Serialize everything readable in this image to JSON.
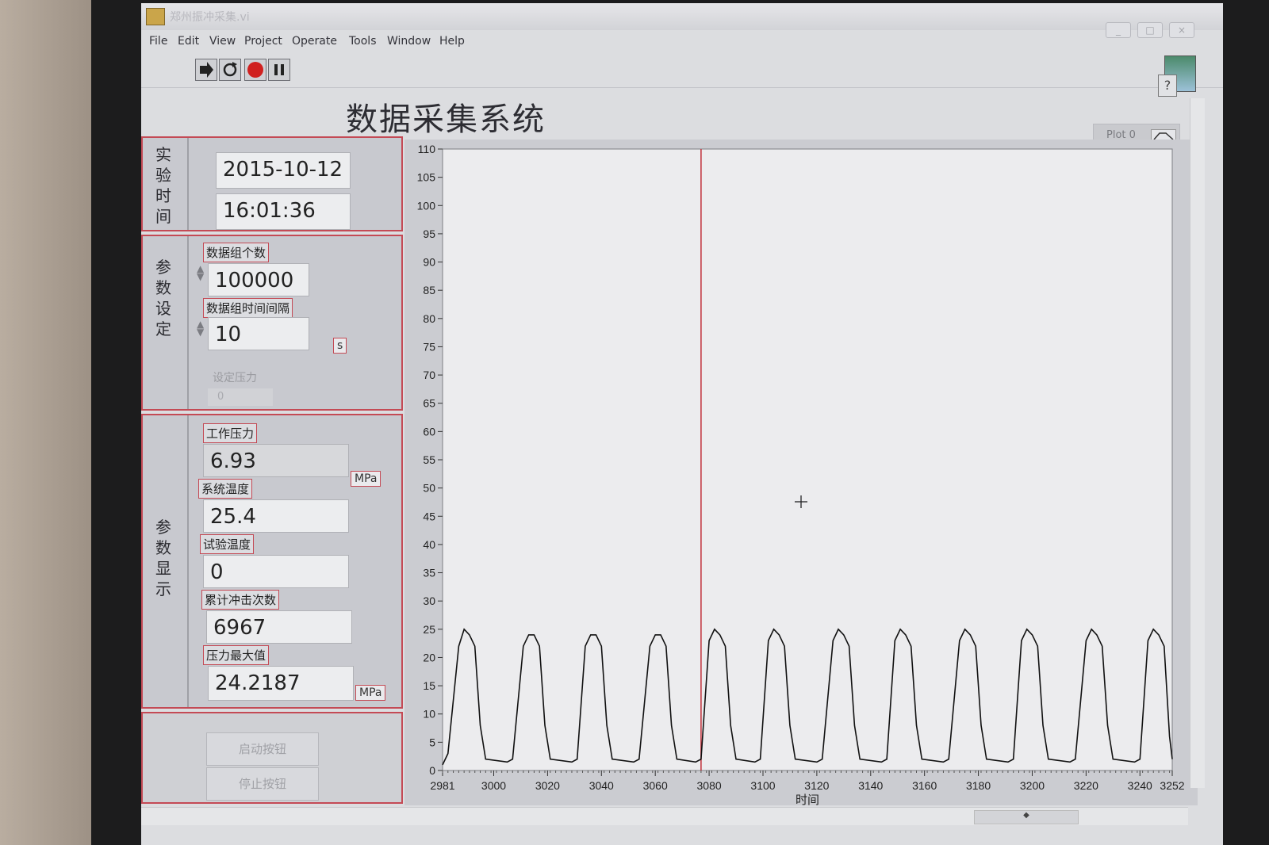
{
  "window": {
    "title": "郑州振冲采集.vi",
    "menu": [
      "File",
      "Edit",
      "View",
      "Project",
      "Operate",
      "Tools",
      "Window",
      "Help"
    ]
  },
  "page_title": "数据采集系统",
  "experiment_time": {
    "label": "实验时间",
    "date": "2015-10-12",
    "time": "16:01:36"
  },
  "params": {
    "label": "参数设定",
    "group_count_label": "数据组个数",
    "group_count": "100000",
    "interval_label": "数据组时间间隔",
    "interval": "10",
    "interval_unit": "s",
    "set_pressure_label": "设定压力",
    "set_pressure": "0"
  },
  "display": {
    "label": "参数显示",
    "work_pressure_label": "工作压力",
    "work_pressure": "6.93",
    "work_pressure_unit": "MPa",
    "sys_temp_label": "系统温度",
    "sys_temp": "25.4",
    "test_temp_label": "试验温度",
    "test_temp": "0",
    "impact_count_label": "累计冲击次数",
    "impact_count": "6967",
    "max_pressure_label": "压力最大值",
    "max_pressure": "24.2187",
    "max_pressure_unit": "MPa"
  },
  "buttons": {
    "start": "启动按钮",
    "stop": "停止按钮"
  },
  "legend": {
    "plot_name": "Plot 0"
  },
  "colors": {
    "panel_border": "#c44a55",
    "trace": "#111111",
    "cursor": "#c0303a"
  },
  "chart_data": {
    "type": "line",
    "xlabel": "时间",
    "ylabel": "",
    "xlim": [
      2981,
      3252
    ],
    "ylim": [
      0,
      110
    ],
    "x_ticks": [
      2981,
      3000,
      3020,
      3040,
      3060,
      3080,
      3100,
      3120,
      3140,
      3160,
      3180,
      3200,
      3220,
      3240,
      3252
    ],
    "y_ticks": [
      0,
      5,
      10,
      15,
      20,
      25,
      30,
      35,
      40,
      45,
      50,
      55,
      60,
      65,
      70,
      75,
      80,
      85,
      90,
      95,
      100,
      105,
      110
    ],
    "cursor_x": 3077,
    "series": [
      {
        "points": [
          [
            2981,
            1
          ],
          [
            2983,
            3
          ],
          [
            2987,
            22
          ],
          [
            2989,
            25
          ],
          [
            2991,
            24
          ],
          [
            2993,
            22
          ],
          [
            2995,
            8
          ],
          [
            2997,
            2
          ],
          [
            3005,
            1.5
          ],
          [
            3007,
            2
          ],
          [
            3011,
            22
          ],
          [
            3013,
            24
          ],
          [
            3015,
            24
          ],
          [
            3017,
            22
          ],
          [
            3019,
            8
          ],
          [
            3021,
            2
          ],
          [
            3029,
            1.5
          ],
          [
            3031,
            2
          ],
          [
            3034,
            22
          ],
          [
            3036,
            24
          ],
          [
            3038,
            24
          ],
          [
            3040,
            22
          ],
          [
            3042,
            8
          ],
          [
            3044,
            2
          ],
          [
            3052,
            1.5
          ],
          [
            3054,
            2
          ],
          [
            3058,
            22
          ],
          [
            3060,
            24
          ],
          [
            3062,
            24
          ],
          [
            3064,
            22
          ],
          [
            3066,
            8
          ],
          [
            3068,
            2
          ],
          [
            3075,
            1.5
          ],
          [
            3077,
            2
          ],
          [
            3080,
            23
          ],
          [
            3082,
            25
          ],
          [
            3084,
            24
          ],
          [
            3086,
            22
          ],
          [
            3088,
            8
          ],
          [
            3090,
            2
          ],
          [
            3097,
            1.5
          ],
          [
            3099,
            2
          ],
          [
            3102,
            23
          ],
          [
            3104,
            25
          ],
          [
            3106,
            24
          ],
          [
            3108,
            22
          ],
          [
            3110,
            8
          ],
          [
            3112,
            2
          ],
          [
            3120,
            1.5
          ],
          [
            3122,
            2
          ],
          [
            3126,
            23
          ],
          [
            3128,
            25
          ],
          [
            3130,
            24
          ],
          [
            3132,
            22
          ],
          [
            3134,
            8
          ],
          [
            3136,
            2
          ],
          [
            3144,
            1.5
          ],
          [
            3146,
            2
          ],
          [
            3149,
            23
          ],
          [
            3151,
            25
          ],
          [
            3153,
            24
          ],
          [
            3155,
            22
          ],
          [
            3157,
            8
          ],
          [
            3159,
            2
          ],
          [
            3167,
            1.5
          ],
          [
            3169,
            2
          ],
          [
            3173,
            23
          ],
          [
            3175,
            25
          ],
          [
            3177,
            24
          ],
          [
            3179,
            22
          ],
          [
            3181,
            8
          ],
          [
            3183,
            2
          ],
          [
            3191,
            1.5
          ],
          [
            3193,
            2
          ],
          [
            3196,
            23
          ],
          [
            3198,
            25
          ],
          [
            3200,
            24
          ],
          [
            3202,
            22
          ],
          [
            3204,
            8
          ],
          [
            3206,
            2
          ],
          [
            3214,
            1.5
          ],
          [
            3216,
            2
          ],
          [
            3220,
            23
          ],
          [
            3222,
            25
          ],
          [
            3224,
            24
          ],
          [
            3226,
            22
          ],
          [
            3228,
            8
          ],
          [
            3230,
            2
          ],
          [
            3238,
            1.5
          ],
          [
            3240,
            2
          ],
          [
            3243,
            23
          ],
          [
            3245,
            25
          ],
          [
            3247,
            24
          ],
          [
            3249,
            22
          ],
          [
            3251,
            6
          ],
          [
            3252,
            2
          ]
        ]
      }
    ]
  }
}
